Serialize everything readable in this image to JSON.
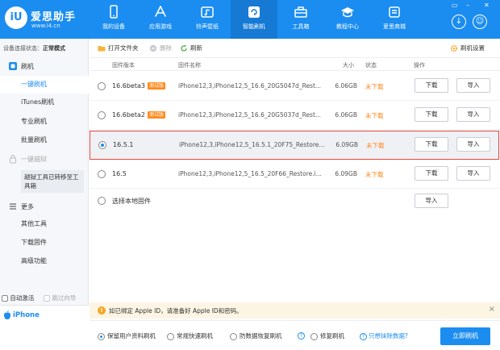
{
  "brand": {
    "logo_mark": "iU",
    "name": "爱思助手",
    "url": "www.i4.cn"
  },
  "nav": [
    {
      "label": "我的设备",
      "icon": "device-icon"
    },
    {
      "label": "应用游戏",
      "icon": "app-store-icon"
    },
    {
      "label": "铃声壁纸",
      "icon": "ringtone-icon"
    },
    {
      "label": "智能刷机",
      "icon": "flash-icon",
      "active": true
    },
    {
      "label": "工具箱",
      "icon": "toolbox-icon"
    },
    {
      "label": "教程中心",
      "icon": "graduation-cap-icon"
    },
    {
      "label": "爱思商城",
      "icon": "store-icon"
    }
  ],
  "window": {
    "download_symbol": "↓",
    "user_symbol": "☺"
  },
  "sidebar": {
    "status_label": "设备连接状态：",
    "status_value": "正常模式",
    "flash_section": "刷机",
    "items": [
      "一键刷机",
      "iTunes刷机",
      "专业刷机",
      "批量刷机"
    ],
    "jailbreak_section": "一键越狱",
    "jailbreak_note": "越狱工具已转移至工具箱",
    "more_section": "更多",
    "more_items": [
      "其他工具",
      "下载固件",
      "高级功能"
    ],
    "auto_activate": "自动激活",
    "skip_guide": "跳过向导",
    "device_name": "iPhone"
  },
  "toolbar": {
    "open_folder": "打开文件夹",
    "delete": "删除",
    "refresh": "刷新",
    "settings": "刷机设置"
  },
  "table": {
    "headers": {
      "version": "固件版本",
      "name": "固件名称",
      "size": "大小",
      "status": "状态",
      "action": "操作"
    },
    "rows": [
      {
        "version": "16.6beta3",
        "tag": "测试版",
        "name": "iPhone12,3,iPhone12,5_16.6_20G5047d_Rest...",
        "size": "6.06GB",
        "status": "未下载",
        "download": "下载",
        "import": "导入",
        "selected": false
      },
      {
        "version": "16.6beta2",
        "tag": "测试版",
        "name": "iPhone12,3,iPhone12,5_16.6_20G5037d_Rest...",
        "size": "6.06GB",
        "status": "未下载",
        "download": "下载",
        "import": "导入",
        "selected": false
      },
      {
        "version": "16.5.1",
        "tag": "",
        "name": "iPhone12,3,iPhone12,5_16.5.1_20F75_Restore...",
        "size": "6.09GB",
        "status": "未下载",
        "download": "下载",
        "import": "导入",
        "selected": true
      },
      {
        "version": "16.5",
        "tag": "",
        "name": "iPhone12,3,iPhone12,5_16.5_20F66_Restore.i...",
        "size": "6.09GB",
        "status": "未下载",
        "download": "下载",
        "import": "导入",
        "selected": false
      }
    ],
    "local_label": "选择本地固件",
    "local_import": "导入"
  },
  "notice": {
    "text": "如已绑定 Apple ID，请准备好 Apple ID和密码。",
    "close": "×"
  },
  "bottom": {
    "options": [
      "保留用户资料刷机",
      "常规快速刷机",
      "防数据恢复刷机",
      "修复刷机"
    ],
    "selected_option": 0,
    "help_symbol": "?",
    "erase_link": "只想抹除数据?",
    "flash_button": "立即刷机"
  }
}
